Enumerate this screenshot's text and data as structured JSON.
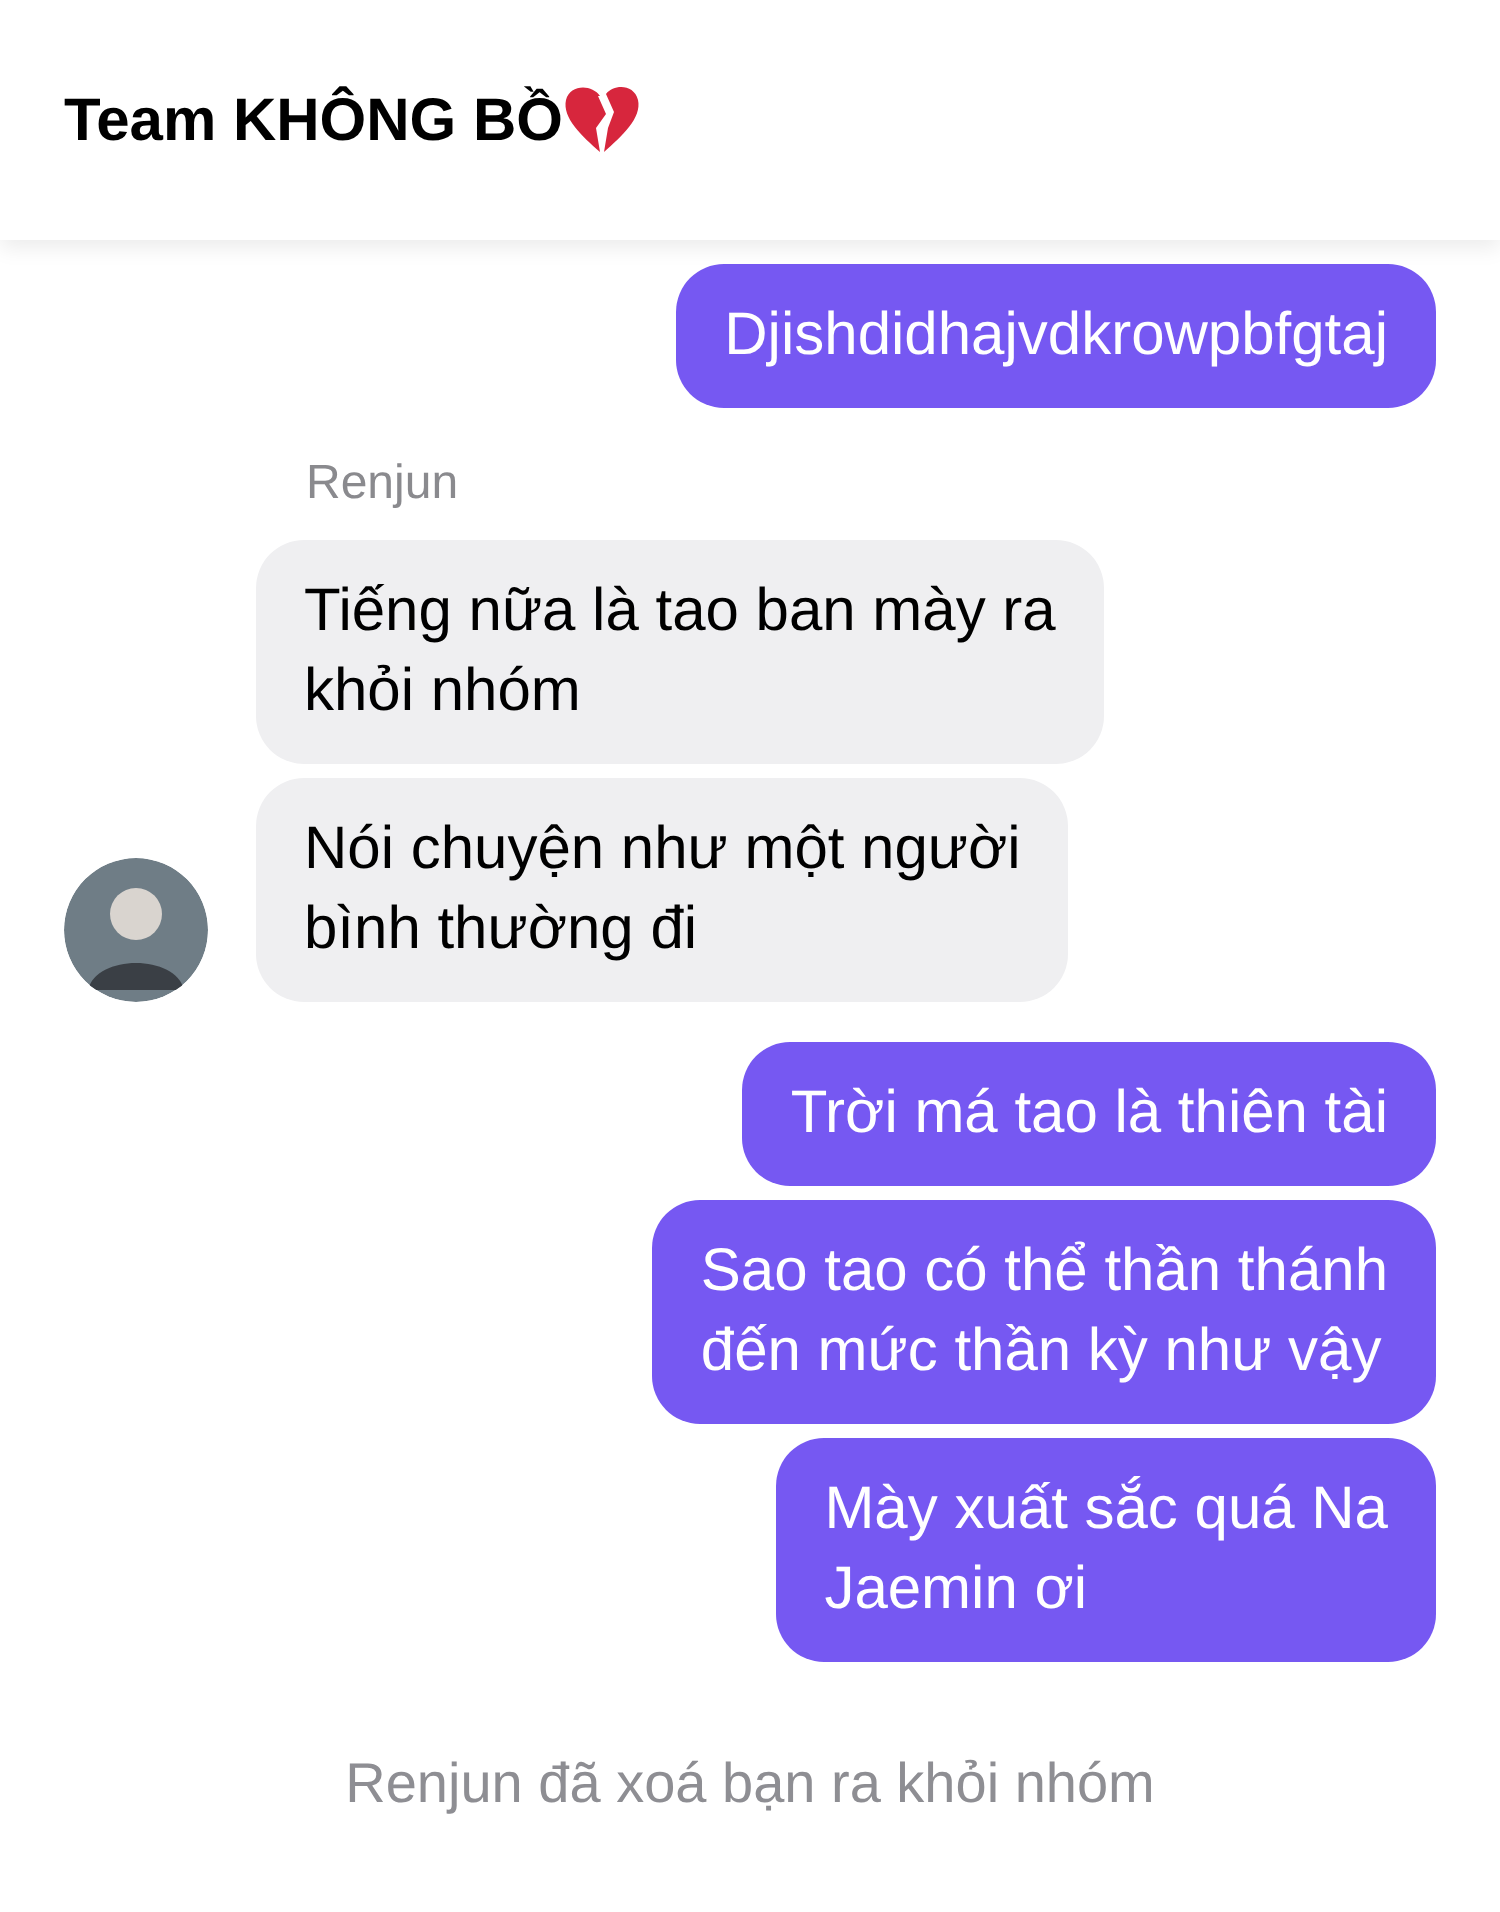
{
  "header": {
    "title": "Team KHÔNG BỒ"
  },
  "messages": [
    {
      "kind": "outgoing",
      "text": "Djishdidhajvdkrowpbfgtaj"
    },
    {
      "kind": "incoming",
      "sender": "Renjun",
      "text": "Tiếng nữa là tao ban mày ra\nkhỏi nhóm",
      "avatar": false
    },
    {
      "kind": "incoming",
      "text": "Nói chuyện như một người\nbình thường đi",
      "avatar": true
    },
    {
      "kind": "outgoing",
      "text": "Trời má tao là thiên tài"
    },
    {
      "kind": "outgoing",
      "text": "Sao tao có thể thần thánh\nđến mức thần kỳ như vậy"
    },
    {
      "kind": "outgoing",
      "text": "Mày xuất sắc quá Na\nJaemin ơi"
    },
    {
      "kind": "system",
      "text": "Renjun đã xoá bạn ra khỏi nhóm"
    }
  ]
}
